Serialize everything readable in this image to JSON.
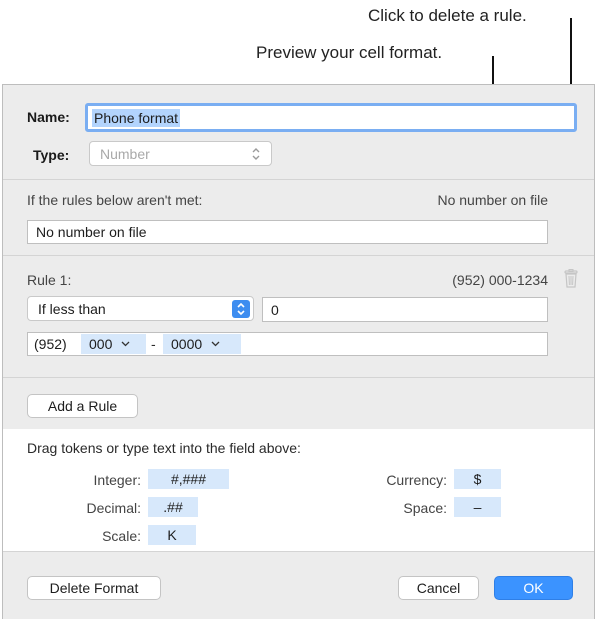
{
  "callouts": {
    "delete_rule": "Click to delete a rule.",
    "preview": "Preview your cell format."
  },
  "dialog": {
    "name_label": "Name:",
    "name_value": "Phone format",
    "type_label": "Type:",
    "type_value": "Number",
    "fallback_label": "If the rules below aren't met:",
    "fallback_preview": "No number on file",
    "fallback_value": "No number on file",
    "rule": {
      "label": "Rule 1:",
      "preview": "(952) 000-1234",
      "condition": "If less than",
      "condition_value": "0",
      "format_prefix": "(952)",
      "token_1": "000",
      "separator": "-",
      "token_2": "0000"
    },
    "add_rule_label": "Add a Rule",
    "tokens_heading": "Drag tokens or type text into the field above:",
    "tokens": {
      "integer_label": "Integer:",
      "integer_value": "#,###",
      "decimal_label": "Decimal:",
      "decimal_value": ".##",
      "scale_label": "Scale:",
      "scale_value": "K",
      "currency_label": "Currency:",
      "currency_value": "$",
      "space_label": "Space:",
      "space_value": "–"
    },
    "footer": {
      "delete_label": "Delete Format",
      "cancel_label": "Cancel",
      "ok_label": "OK"
    }
  },
  "colors": {
    "accent": "#3b93ff",
    "token_bg": "#d7e8fb",
    "panel_bg": "#ececec"
  }
}
